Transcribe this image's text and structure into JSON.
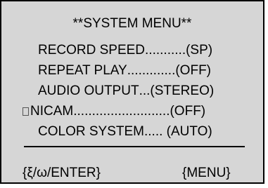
{
  "menu": {
    "title": "**SYSTEM MENU**",
    "items": [
      {
        "label": "RECORD SPEED",
        "value": "...........(SP)",
        "selected": false
      },
      {
        "label": "REPEAT PLAY",
        "value": ".............(OFF)",
        "selected": false
      },
      {
        "label": "AUDIO OUTPUT",
        "value": "...(STEREO)",
        "selected": false
      },
      {
        "label": "NICAM",
        "value": "..........................(OFF)",
        "selected": true
      },
      {
        "label": "COLOR SYSTEM",
        "value": "..... (AUTO)",
        "selected": false
      }
    ],
    "cursor_icon": "selection-cursor-box"
  },
  "footer": {
    "left_label": "{ξ/ω/ENTER}",
    "right_label": "{MENU}"
  }
}
